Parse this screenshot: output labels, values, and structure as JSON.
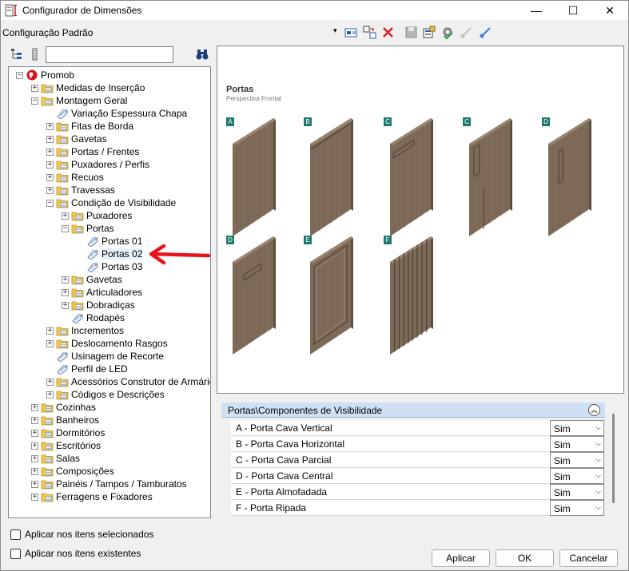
{
  "window": {
    "title": "Configurador de Dimensões",
    "minimize_glyph": "—",
    "maximize_glyph": "☐",
    "close_glyph": "✕"
  },
  "toolbar": {
    "config_name": "Configuração Padrão",
    "dropdown_glyph": "▾",
    "icons": [
      "properties-icon",
      "copy-icon",
      "delete-icon",
      "save-icon",
      "export-icon",
      "settings-icon",
      "expand-icon",
      "collapse-icon"
    ]
  },
  "tree_toolbar": {
    "search_value": "",
    "search_icon": "binoculars-icon"
  },
  "tree": [
    {
      "label": "Promob",
      "level": 0,
      "type": "root",
      "expander": "−"
    },
    {
      "label": "Medidas de Inserção",
      "level": 1,
      "type": "folder",
      "expander": "+"
    },
    {
      "label": "Montagem Geral",
      "level": 1,
      "type": "folder",
      "expander": "−"
    },
    {
      "label": "Variação Espessura Chapa",
      "level": 2,
      "type": "leaf",
      "expander": ""
    },
    {
      "label": "Fitas de Borda",
      "level": 2,
      "type": "folder",
      "expander": "+"
    },
    {
      "label": "Gavetas",
      "level": 2,
      "type": "folder",
      "expander": "+"
    },
    {
      "label": "Portas / Frentes",
      "level": 2,
      "type": "folder",
      "expander": "+"
    },
    {
      "label": "Puxadores / Perfis",
      "level": 2,
      "type": "folder",
      "expander": "+"
    },
    {
      "label": "Recuos",
      "level": 2,
      "type": "folder",
      "expander": "+"
    },
    {
      "label": "Travessas",
      "level": 2,
      "type": "folder",
      "expander": "+"
    },
    {
      "label": "Condição de Visibilidade",
      "level": 2,
      "type": "folder",
      "expander": "−"
    },
    {
      "label": "Puxadores",
      "level": 3,
      "type": "folder",
      "expander": "+"
    },
    {
      "label": "Portas",
      "level": 3,
      "type": "folder",
      "expander": "−"
    },
    {
      "label": "Portas 01",
      "level": 4,
      "type": "leaf",
      "expander": ""
    },
    {
      "label": "Portas 02",
      "level": 4,
      "type": "leaf",
      "expander": "",
      "selected": true
    },
    {
      "label": "Portas 03",
      "level": 4,
      "type": "leaf",
      "expander": ""
    },
    {
      "label": "Gavetas",
      "level": 3,
      "type": "folder",
      "expander": "+"
    },
    {
      "label": "Articuladores",
      "level": 3,
      "type": "folder",
      "expander": "+"
    },
    {
      "label": "Dobradiças",
      "level": 3,
      "type": "folder",
      "expander": "+"
    },
    {
      "label": "Rodapés",
      "level": 3,
      "type": "leaf",
      "expander": ""
    },
    {
      "label": "Incrementos",
      "level": 2,
      "type": "folder",
      "expander": "+"
    },
    {
      "label": "Deslocamento Rasgos",
      "level": 2,
      "type": "folder",
      "expander": "+"
    },
    {
      "label": "Usinagem de Recorte",
      "level": 2,
      "type": "leaf",
      "expander": ""
    },
    {
      "label": "Perfil de LED",
      "level": 2,
      "type": "leaf",
      "expander": ""
    },
    {
      "label": "Acessórios Construtor de Armários",
      "level": 2,
      "type": "folder",
      "expander": "+"
    },
    {
      "label": "Códigos e Descrições",
      "level": 2,
      "type": "folder",
      "expander": "+"
    },
    {
      "label": "Cozinhas",
      "level": 1,
      "type": "folder",
      "expander": "+"
    },
    {
      "label": "Banheiros",
      "level": 1,
      "type": "folder",
      "expander": "+"
    },
    {
      "label": "Dormitórios",
      "level": 1,
      "type": "folder",
      "expander": "+"
    },
    {
      "label": "Escritórios",
      "level": 1,
      "type": "folder",
      "expander": "+"
    },
    {
      "label": "Salas",
      "level": 1,
      "type": "folder",
      "expander": "+"
    },
    {
      "label": "Composições",
      "level": 1,
      "type": "folder",
      "expander": "+"
    },
    {
      "label": "Painéis / Tampos / Tamburatos",
      "level": 1,
      "type": "folder",
      "expander": "+"
    },
    {
      "label": "Ferragens e Fixadores",
      "level": 1,
      "type": "folder",
      "expander": "+"
    }
  ],
  "preview": {
    "title": "Portas",
    "subtitle": "Perspectiva Frontal",
    "doors": [
      {
        "badge": "A",
        "style": "plain"
      },
      {
        "badge": "B",
        "style": "horizontal-top"
      },
      {
        "badge": "C",
        "style": "partial-top"
      },
      {
        "badge": "C",
        "style": "partial-side"
      },
      {
        "badge": "D",
        "style": "central-vertical"
      },
      {
        "badge": "D",
        "style": "central-horizontal"
      },
      {
        "badge": "E",
        "style": "raised-panel"
      },
      {
        "badge": "F",
        "style": "slatted"
      }
    ],
    "colors": {
      "wood_front": "#7d6a58",
      "wood_side": "#5e4f41",
      "wood_top": "#9a8672",
      "badge": "#1e7a6a"
    }
  },
  "properties": {
    "header": "Portas\\Componentes de Visibilidade",
    "collapse_glyph": "︽",
    "rows": [
      {
        "name": "A - Porta Cava Vertical",
        "value": "Sim"
      },
      {
        "name": "B - Porta Cava Horizontal",
        "value": "Sim"
      },
      {
        "name": "C - Porta Cava Parcial",
        "value": "Sim"
      },
      {
        "name": "D - Porta Cava Central",
        "value": "Sim"
      },
      {
        "name": "E - Porta Almofadada",
        "value": "Sim"
      },
      {
        "name": "F - Porta Ripada",
        "value": "Sim"
      }
    ],
    "dropdown_glyph": "⌵"
  },
  "footer": {
    "check_selected": "Aplicar nos itens selecionados",
    "check_existing": "Aplicar nos itens existentes",
    "apply": "Aplicar",
    "ok": "OK",
    "cancel": "Cancelar"
  },
  "annotation": {
    "color": "#e8141c"
  }
}
